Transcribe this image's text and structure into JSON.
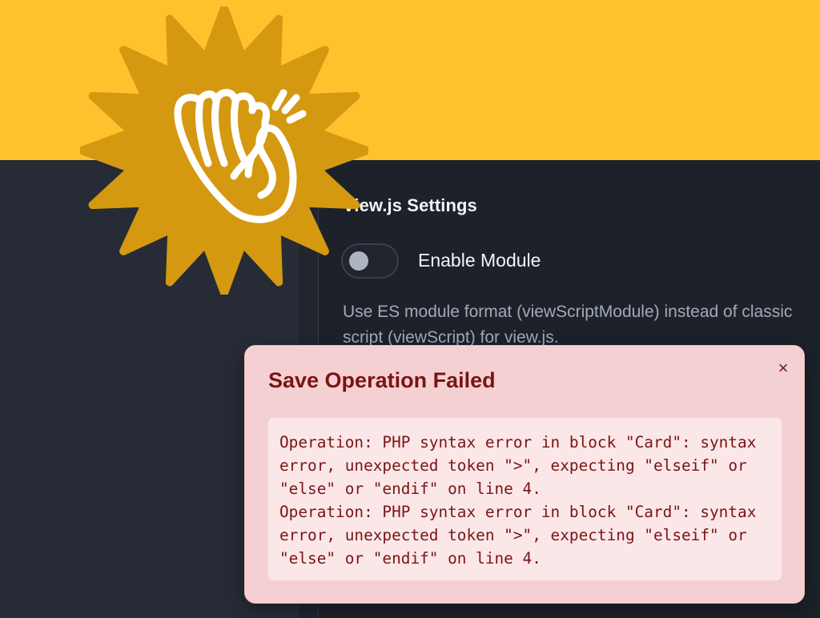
{
  "badge": {
    "icon": "clapping-hand-icon",
    "color": "#d49910",
    "stroke": "#ffffff"
  },
  "settings": {
    "section_title": "View.js Settings",
    "toggle": {
      "label": "Enable Module",
      "enabled": false
    },
    "description": "Use ES module format (viewScriptModule) instead of classic script (viewScript) for view.js."
  },
  "toast": {
    "title": "Save Operation Failed",
    "close_label": "×",
    "message": "Operation: PHP syntax error in block \"Card\": syntax error, unexpected token \">\", expecting \"elseif\" or \"else\" or \"endif\" on line 4.\nOperation: PHP syntax error in block \"Card\": syntax error, unexpected token \">\", expecting \"elseif\" or \"else\" or \"endif\" on line 4."
  },
  "colors": {
    "banner": "#ffc22d",
    "dark_bg": "#1d2129",
    "sidebar_bg": "#262b35",
    "error_bg": "#f5d0d2",
    "error_text": "#7a1414"
  }
}
